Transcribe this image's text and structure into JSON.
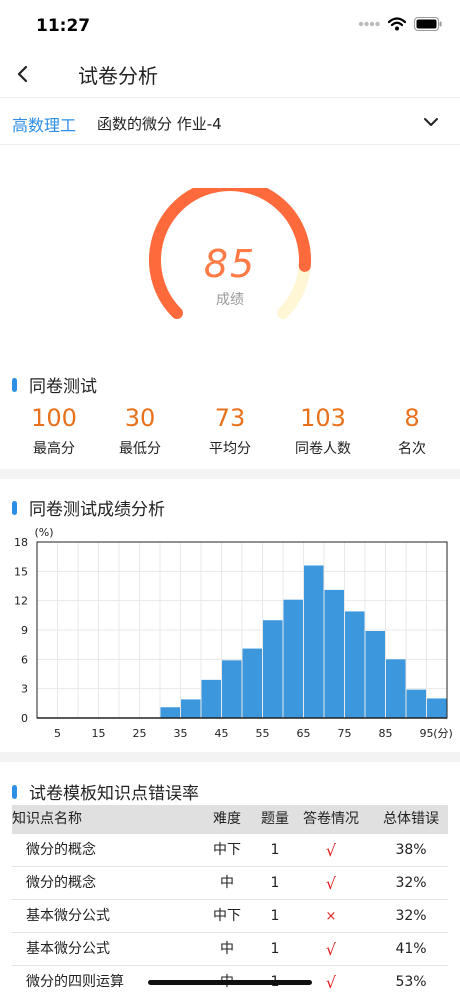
{
  "status": {
    "time": "11:27"
  },
  "nav": {
    "title": "试卷分析"
  },
  "course": {
    "subject": "高数理工",
    "homework": "函数的微分 作业-4"
  },
  "score": {
    "value": "85",
    "label": "成绩",
    "fraction": 0.85,
    "colors": {
      "arc": "#ff6a3d",
      "track": "#fff6d6"
    }
  },
  "test_section": {
    "title": "同卷测试",
    "stats": [
      {
        "value": "100",
        "label": "最高分"
      },
      {
        "value": "30",
        "label": "最低分"
      },
      {
        "value": "73",
        "label": "平均分"
      },
      {
        "value": "103",
        "label": "同卷人数"
      },
      {
        "value": "8",
        "label": "名次"
      }
    ]
  },
  "dist_section": {
    "title": "同卷测试成绩分析"
  },
  "chart_data": {
    "type": "bar",
    "ylabel": "(%)",
    "xunit": "(分)",
    "ylim": [
      0,
      18
    ],
    "yticks": [
      0,
      3,
      6,
      9,
      12,
      15,
      18
    ],
    "xticks": [
      5,
      15,
      25,
      35,
      45,
      55,
      65,
      75,
      85,
      95
    ],
    "bins": [
      0,
      5,
      10,
      15,
      20,
      25,
      30,
      35,
      40,
      45,
      50,
      55,
      60,
      65,
      70,
      75,
      80,
      85,
      90,
      95,
      100
    ],
    "values": [
      0,
      0,
      0,
      0,
      0,
      0,
      1.1,
      1.9,
      3.9,
      5.9,
      7.1,
      10.0,
      12.1,
      15.6,
      13.1,
      10.9,
      8.9,
      6.0,
      2.9,
      2.0
    ],
    "colors": {
      "bar": "#3d97dc",
      "grid": "#e8e8e8"
    },
    "grid": true
  },
  "knowledge_section": {
    "title": "试卷模板知识点错误率",
    "headers": {
      "name": "知识点名称",
      "difficulty": "难度",
      "count": "题量",
      "answer": "答卷情况",
      "error": "总体错误"
    },
    "rows": [
      {
        "name": "微分的概念",
        "difficulty": "中下",
        "count": "1",
        "answer": "√",
        "error": "38%"
      },
      {
        "name": "微分的概念",
        "difficulty": "中",
        "count": "1",
        "answer": "√",
        "error": "32%"
      },
      {
        "name": "基本微分公式",
        "difficulty": "中下",
        "count": "1",
        "answer": "×",
        "error": "32%"
      },
      {
        "name": "基本微分公式",
        "difficulty": "中",
        "count": "1",
        "answer": "√",
        "error": "41%"
      },
      {
        "name": "微分的四则运算",
        "difficulty": "中",
        "count": "1",
        "answer": "√",
        "error": "53%"
      }
    ]
  }
}
